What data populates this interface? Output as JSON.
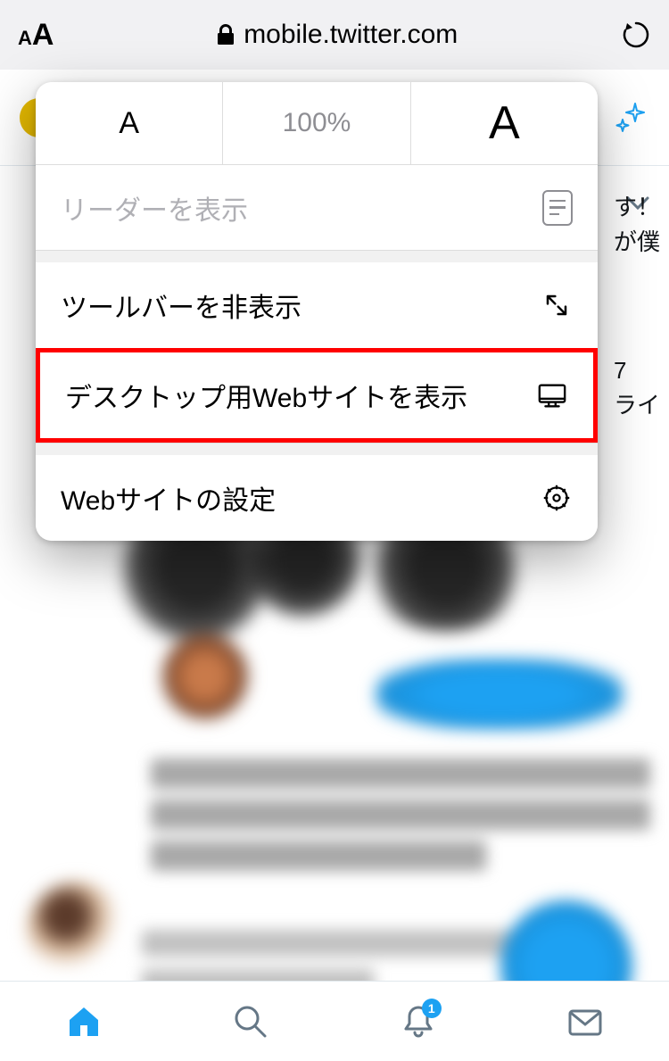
{
  "url_bar": {
    "text_size_button": "aA",
    "domain": "mobile.twitter.com"
  },
  "popover": {
    "zoom_level": "100%",
    "reader_label": "リーダーを表示",
    "items": [
      {
        "label": "ツールバーを非表示",
        "icon": "expand-arrows-icon"
      },
      {
        "label": "デスクトップ用Webサイトを表示",
        "icon": "desktop-icon",
        "highlighted": true
      },
      {
        "label": "Webサイトの設定",
        "icon": "gear-icon"
      }
    ]
  },
  "background_fragments": {
    "line1": "す！",
    "line2": "が僕",
    "line3": "7",
    "line4": "ライ"
  },
  "bottom_nav": {
    "badge_count": "1"
  }
}
